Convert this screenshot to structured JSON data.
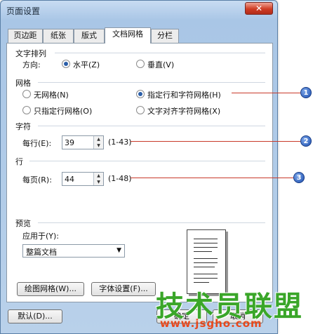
{
  "window": {
    "title": "页面设置",
    "close": "✕"
  },
  "tabs": [
    "页边距",
    "纸张",
    "版式",
    "文档网格",
    "分栏"
  ],
  "text_direction": {
    "heading": "文字排列",
    "label": "方向:",
    "horizontal": "水平(Z)",
    "vertical": "垂直(V)"
  },
  "grid": {
    "heading": "网格",
    "none": "无网格(N)",
    "line_and_char": "指定行和字符网格(H)",
    "line_only": "只指定行网格(O)",
    "snap_char": "文字对齐字符网格(X)"
  },
  "chars": {
    "heading": "字符",
    "label": "每行(E):",
    "value": "39",
    "range": "(1-43)"
  },
  "lines": {
    "heading": "行",
    "label": "每页(R):",
    "value": "44",
    "range": "(1-48)"
  },
  "preview": {
    "heading": "预览",
    "apply_label": "应用于(Y):",
    "apply_value": "整篇文档"
  },
  "buttons": {
    "draw_grid": "绘图网格(W)...",
    "font_settings": "字体设置(F)...",
    "default": "默认(D)...",
    "ok": "确定",
    "cancel": "取消"
  },
  "callouts": [
    "1",
    "2",
    "3"
  ],
  "watermark": {
    "logo": "技术员联盟",
    "url": "www.jsgho.com"
  }
}
